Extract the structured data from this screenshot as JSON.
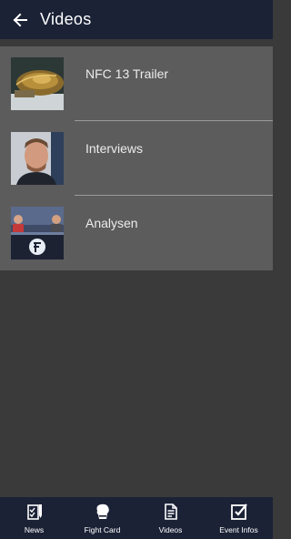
{
  "header": {
    "title": "Videos",
    "back_icon": "arrow-left-icon"
  },
  "videos": [
    {
      "label": "NFC 13 Trailer",
      "thumb": "golden-belt-thumbnail"
    },
    {
      "label": "Interviews",
      "thumb": "fighter-portrait-thumbnail"
    },
    {
      "label": "Analysen",
      "thumb": "studio-desk-thumbnail"
    }
  ],
  "nav": [
    {
      "label": "News",
      "icon": "news-icon"
    },
    {
      "label": "Fight Card",
      "icon": "boxing-glove-icon"
    },
    {
      "label": "Videos",
      "icon": "document-icon"
    },
    {
      "label": "Event Infos",
      "icon": "checkbox-icon"
    }
  ],
  "colors": {
    "appbar": "#1b2236",
    "list_background": "#5c5c5c",
    "page_background": "#3a3a3a",
    "text": "#ffffff"
  }
}
